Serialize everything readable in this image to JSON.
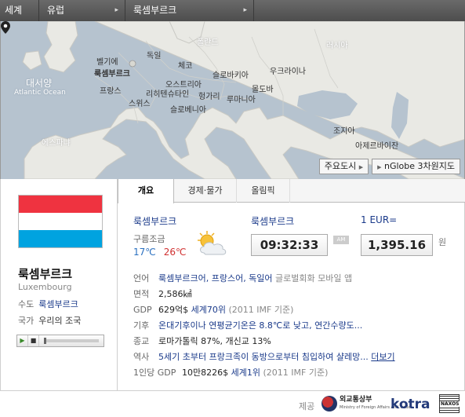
{
  "breadcrumb": {
    "world": "세계",
    "region": "유럽",
    "country": "룩셈부르크",
    "arrow": "▸"
  },
  "map": {
    "labels": {
      "atlantic_ko": "대서양",
      "atlantic_en": "Atlantic Ocean",
      "poland": "폴란드",
      "russia": "러시아",
      "belgium": "벨기에",
      "germany": "독일",
      "luxembourg": "룩셈부르크",
      "czech": "체코",
      "ukraine": "우크라이나",
      "france": "프랑스",
      "austria": "오스트리아",
      "slovakia": "슬로바키아",
      "moldova": "몰도바",
      "liechtenstein": "리히텐슈타인",
      "switzerland": "스위스",
      "hungary": "헝가리",
      "romania": "루마니아",
      "slovenia": "슬로베니아",
      "spain": "에스파냐",
      "georgia": "조지아",
      "azerbaijan": "아제르바이잔"
    },
    "buttons": {
      "major_cities": "주요도시",
      "nglobe": "nGlobe 3차원지도"
    }
  },
  "country": {
    "name": "룩셈부르크",
    "name_en": "Luxembourg",
    "capital_label": "수도",
    "capital": "룩셈부르크",
    "anthem_label": "국가",
    "anthem": "우리의 조국",
    "flag_colors": [
      "#ef3340",
      "#ffffff",
      "#00a3e0"
    ]
  },
  "tabs": [
    "개요",
    "경제·물가",
    "올림픽"
  ],
  "weather": {
    "city": "룩셈부르크",
    "desc": "구름조금",
    "low": "17℃",
    "high": "26℃"
  },
  "time": {
    "city": "룩셈부르크",
    "value": "09:32:33",
    "ampm": "AM"
  },
  "exchange": {
    "label": "1 EUR=",
    "value": "1,395.16",
    "unit": "원"
  },
  "info": {
    "language": {
      "label": "언어",
      "value": "룩셈부르크어, 프랑스어, 독일어",
      "extra": "글로벌회화 모바일 앱"
    },
    "area": {
      "label": "면적",
      "value": "2,586㎢"
    },
    "gdp": {
      "label": "GDP",
      "value": "629억$",
      "rank": "세계70위",
      "source": "(2011 IMF 기준)"
    },
    "climate": {
      "label": "기후",
      "value": "온대기후이나 연평균기온은 8.8℃로 낮고, 연간수량도..."
    },
    "religion": {
      "label": "종교",
      "value": "로마가톨릭 87%, 개신교 13%"
    },
    "history": {
      "label": "역사",
      "value": "5세기 초부터 프랑크족이 동방으로부터 침입하여 샬레망...",
      "more": "더보기"
    },
    "gdp_per_capita": {
      "label": "1인당 GDP",
      "value": "10만8226$",
      "rank": "세계1위",
      "source": "(2011 IMF 기준)"
    }
  },
  "footer": {
    "provided": "제공",
    "mofa": "외교통상부",
    "mofa_en": "Ministry of Foreign Affairs And Trade",
    "kotra": "kotra",
    "naxos": "NAXOS"
  }
}
